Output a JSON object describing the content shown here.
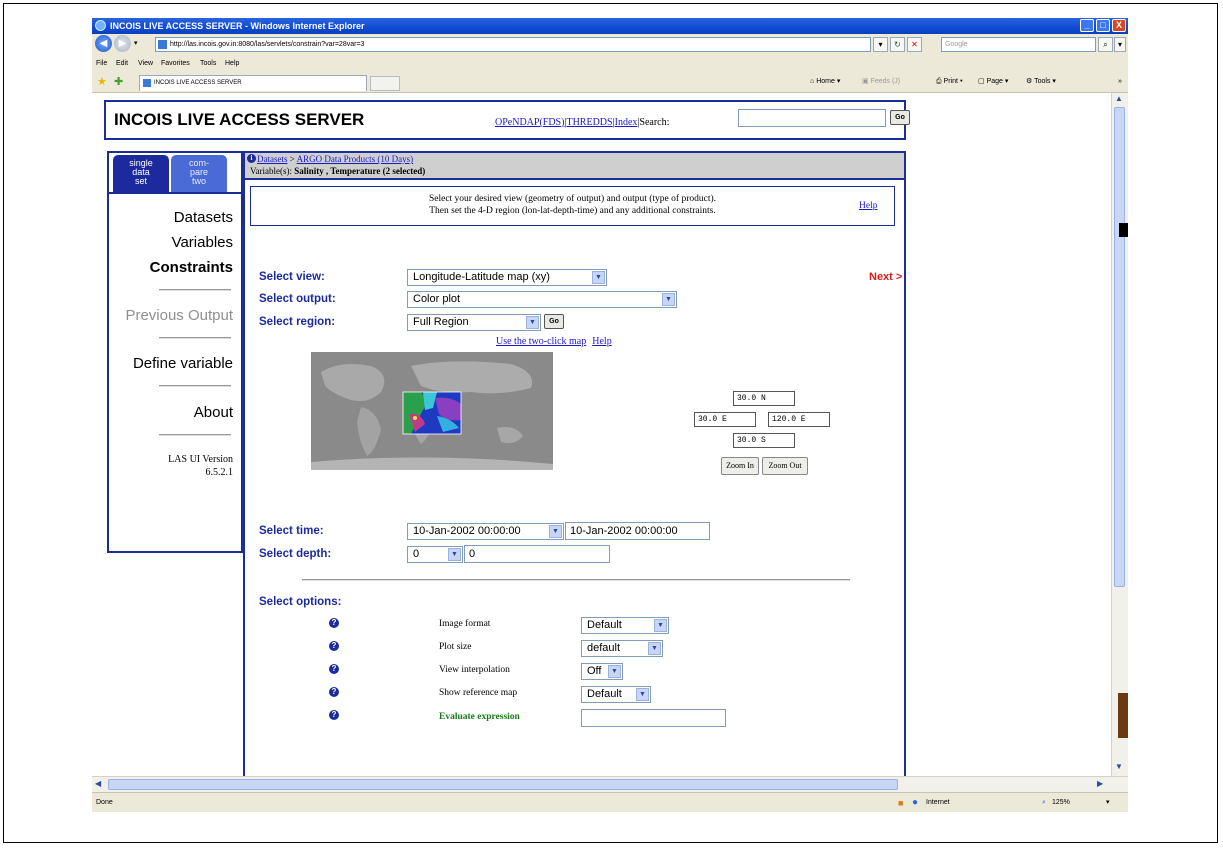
{
  "window": {
    "title": "INCOIS LIVE ACCESS SERVER - Windows Internet Explorer",
    "controls": [
      "_",
      "□",
      "X"
    ]
  },
  "address_bar": {
    "url": "http://las.incois.gov.in:8080/las/servlets/constrain?var=28var=3",
    "search_placeholder": "Google"
  },
  "menu": [
    "File",
    "Edit",
    "View",
    "Favorites",
    "Tools",
    "Help"
  ],
  "tab": {
    "label": "INCOIS LIVE ACCESS SERVER"
  },
  "command_bar": {
    "home": "Home",
    "feeds": "Feeds (J)",
    "print": "Print",
    "page": "Page",
    "tools": "Tools"
  },
  "header": {
    "title": "INCOIS LIVE ACCESS SERVER",
    "links": [
      "OPeNDAP(FDS)",
      "THREDDS",
      "Index"
    ],
    "search_label": "Search:",
    "go_label": "Go"
  },
  "sidebar": {
    "tab_single": [
      "single",
      "data",
      "set"
    ],
    "tab_compare": [
      "com-",
      "pare",
      "two"
    ],
    "items": [
      "Datasets",
      "Variables",
      "Constraints",
      "Previous Output",
      "Define variable",
      "About"
    ],
    "version_line1": "LAS UI Version",
    "version_line2": "6.5.2.1"
  },
  "breadcrumb": {
    "datasets": "Datasets",
    "sep": " > ",
    "current": "ARGO Data Products (10 Days)",
    "variables_label": "Variable(s):",
    "variables_value": "Salinity , Temperature (2 selected)"
  },
  "instructions": {
    "line1": "Select your desired view (geometry of output) and output (type of product).",
    "line2": "Then set the 4-D region (lon-lat-depth-time) and any additional constraints.",
    "help": "Help"
  },
  "form": {
    "view_label": "Select view:",
    "view_value": "Longitude-Latitude map (xy)",
    "next": "Next >",
    "output_label": "Select output:",
    "output_value": "Color plot",
    "region_label": "Select region:",
    "region_value": "Full Region",
    "go": "Go",
    "map_link": "Use the two-click map",
    "map_help": "Help",
    "north": "30.0 N",
    "west": "30.0 E",
    "east": "120.0 E",
    "south": "30.0 S",
    "zoom_in": "Zoom In",
    "zoom_out": "Zoom Out",
    "time_label": "Select time:",
    "time_start": "10-Jan-2002 00:00:00",
    "time_end": "10-Jan-2002 00:00:00",
    "depth_label": "Select depth:",
    "depth_start": "0",
    "depth_end": "0",
    "options_label": "Select options:"
  },
  "options": [
    {
      "label": "Image format",
      "value": "Default"
    },
    {
      "label": "Plot size",
      "value": "default"
    },
    {
      "label": "View interpolation",
      "value": "Off"
    },
    {
      "label": "Show reference map",
      "value": "Default"
    },
    {
      "label": "Evaluate expression",
      "value": ""
    }
  ],
  "status": {
    "left": "Done",
    "zone": "Internet",
    "zoom": "125%"
  }
}
